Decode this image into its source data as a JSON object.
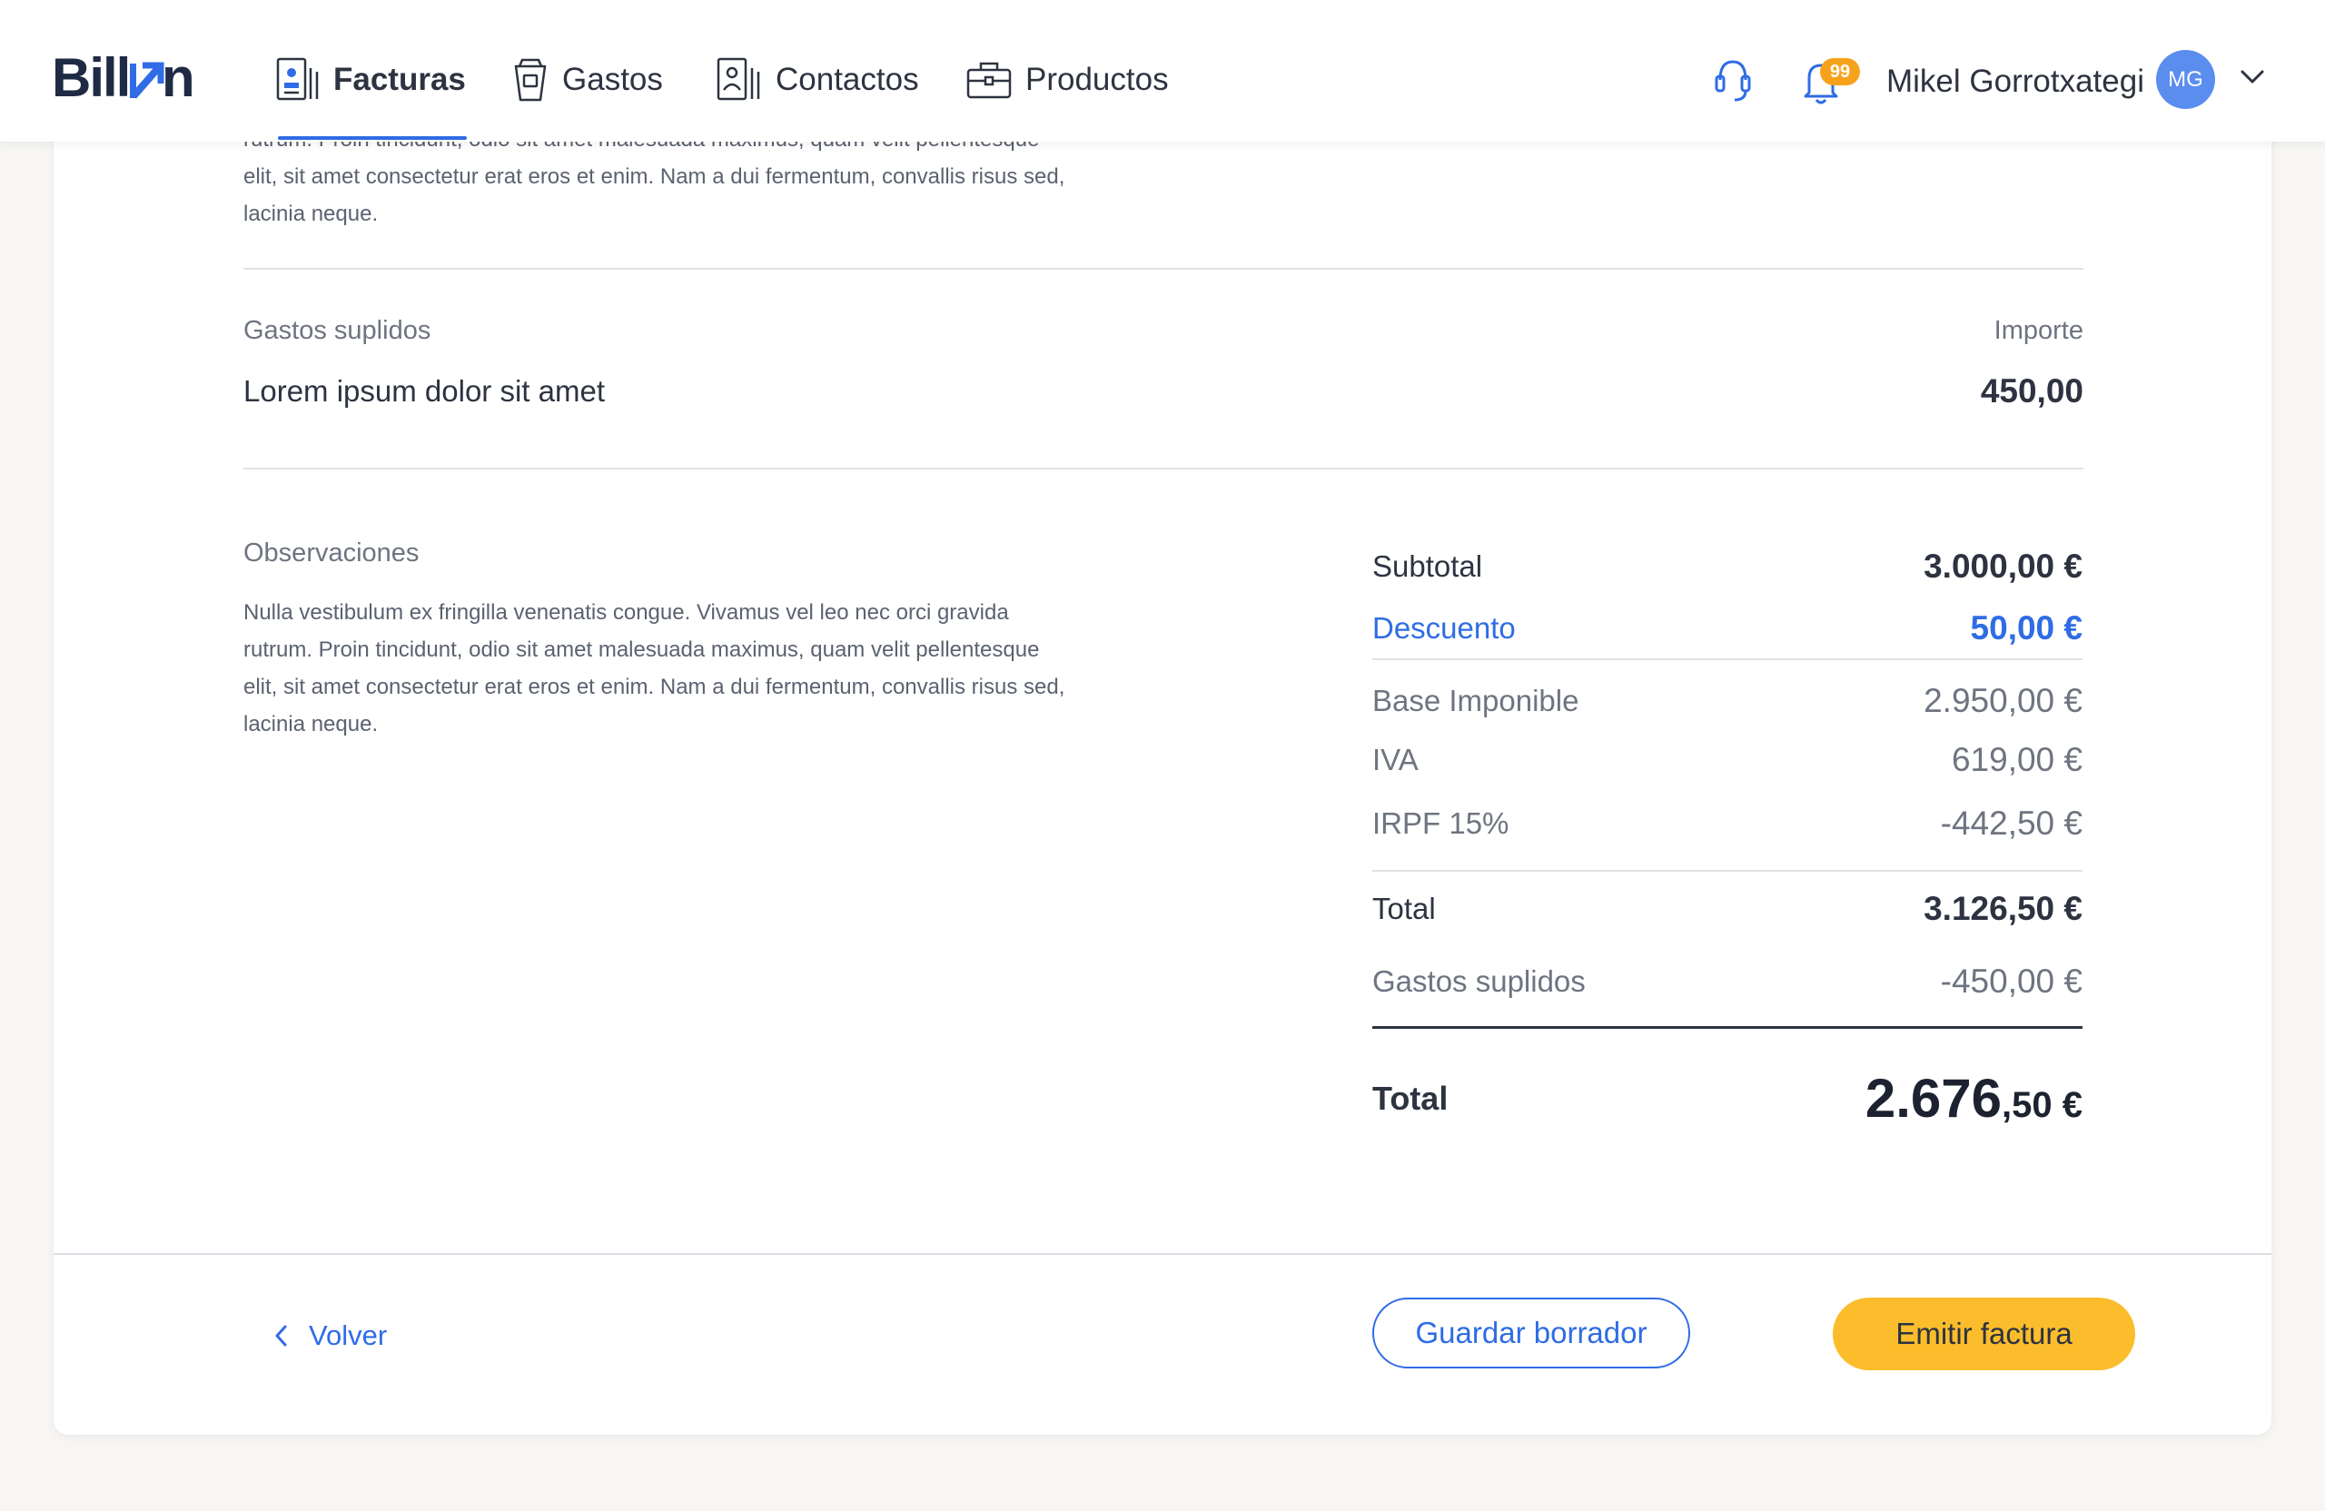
{
  "header": {
    "logo_text": "Billin",
    "nav": [
      {
        "label": "Facturas",
        "icon": "invoice-icon",
        "active": true
      },
      {
        "label": "Gastos",
        "icon": "cup-icon",
        "active": false
      },
      {
        "label": "Contactos",
        "icon": "contacts-icon",
        "active": false
      },
      {
        "label": "Productos",
        "icon": "briefcase-icon",
        "active": false
      }
    ],
    "notification_count": "99",
    "user_name": "Mikel Gorrotxategi",
    "user_initials": "MG"
  },
  "top_paragraph": {
    "lines": [
      "rutrum. Proin tincidunt, odio sit amet malesuada maximus, quam velit pellentesque",
      "elit, sit amet consectetur erat eros et enim. Nam a dui fermentum, convallis risus sed,",
      "lacinia neque."
    ]
  },
  "gastos_suplidos": {
    "header_label": "Gastos suplidos",
    "amount_header": "Importe",
    "item_description": "Lorem ipsum dolor sit amet",
    "item_amount": "450,00"
  },
  "observaciones": {
    "label": "Observaciones",
    "lines": [
      "Nulla vestibulum ex fringilla venenatis congue. Vivamus vel leo nec orci gravida",
      "rutrum. Proin tincidunt, odio sit amet malesuada maximus, quam velit pellentesque",
      "elit, sit amet consectetur erat eros et enim. Nam a dui fermentum, convallis risus sed,",
      "lacinia neque."
    ]
  },
  "totals": {
    "subtotal": {
      "label": "Subtotal",
      "value": "3.000,00 €"
    },
    "descuento": {
      "label": "Descuento",
      "value": "50,00 €"
    },
    "base_imponible": {
      "label": "Base Imponible",
      "value": "2.950,00 €"
    },
    "iva": {
      "label": "IVA",
      "value": "619,00 €"
    },
    "irpf": {
      "label": "IRPF 15%",
      "value": "-442,50 €"
    },
    "total": {
      "label": "Total",
      "value": "3.126,50 €"
    },
    "gastos_suplidos": {
      "label": "Gastos suplidos",
      "value": "-450,00 €"
    },
    "grand_total": {
      "label": "Total",
      "integer": "2.676",
      "decimal": ",50 €"
    }
  },
  "footer": {
    "back_label": "Volver",
    "save_draft_label": "Guardar borrador",
    "issue_label": "Emitir factura"
  },
  "colors": {
    "accent": "#2f6ce5",
    "primary_button": "#fbbd2b",
    "badge": "#f6a31b",
    "avatar": "#5b8def"
  }
}
